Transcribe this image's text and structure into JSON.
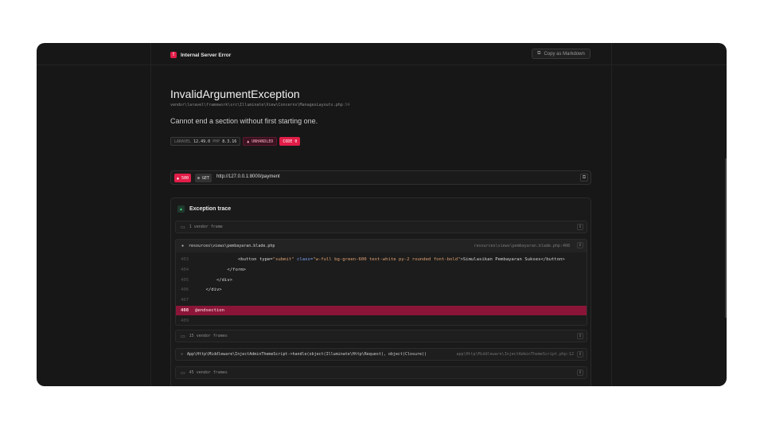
{
  "header": {
    "title": "Internal Server Error",
    "copy_button": "Copy as Markdown"
  },
  "exception": {
    "name": "InvalidArgumentException",
    "file": "vendor\\laravel\\framework\\src\\Illuminate\\View\\Concerns\\ManagesLayouts.php",
    "line": ":94",
    "message": "Cannot end a section without first starting one."
  },
  "badges": {
    "laravel_label": "LARAVEL",
    "laravel_version": "12.49.0",
    "php_label": "PHP",
    "php_version": "8.3.16",
    "unhandled": "UNHANDLED",
    "code": "CODE 0"
  },
  "request": {
    "status": "500",
    "method": "GET",
    "url": "http://127.0.0.1:8000/payment"
  },
  "trace": {
    "title": "Exception trace",
    "vendor_frames_1": "1 vendor frame",
    "frame_file": "resources\\views\\pembayaran.blade.php",
    "frame_location": "resources\\views\\pembayaran.blade.php:408",
    "code_lines": [
      {
        "num": "403",
        "indent": "                ",
        "before": "<button type=",
        "s1": "\"submit\"",
        "mid": " class=",
        "s2": "\"w-full bg-green-600 text-white py-2 rounded font-bold\"",
        "after": ">Simulasikan Pembayaran Sukses</button>"
      },
      {
        "num": "404",
        "text": "            </form>"
      },
      {
        "num": "405",
        "text": "        </div>"
      },
      {
        "num": "406",
        "text": "    </div>"
      },
      {
        "num": "407",
        "text": ""
      },
      {
        "num": "408",
        "text": "@endsection",
        "highlight": true
      },
      {
        "num": "409",
        "text": ""
      }
    ],
    "vendor_frames_15": "15 vendor frames",
    "middleware_frame": "App\\Http\\Middleware\\InjectAdminThemeScript->handle(object(Illuminate\\Http\\Request), object(Closure))",
    "middleware_location": "app\\Http\\Middleware\\InjectAdminThemeScript.php:12",
    "vendor_frames_45": "45 vendor frames"
  }
}
